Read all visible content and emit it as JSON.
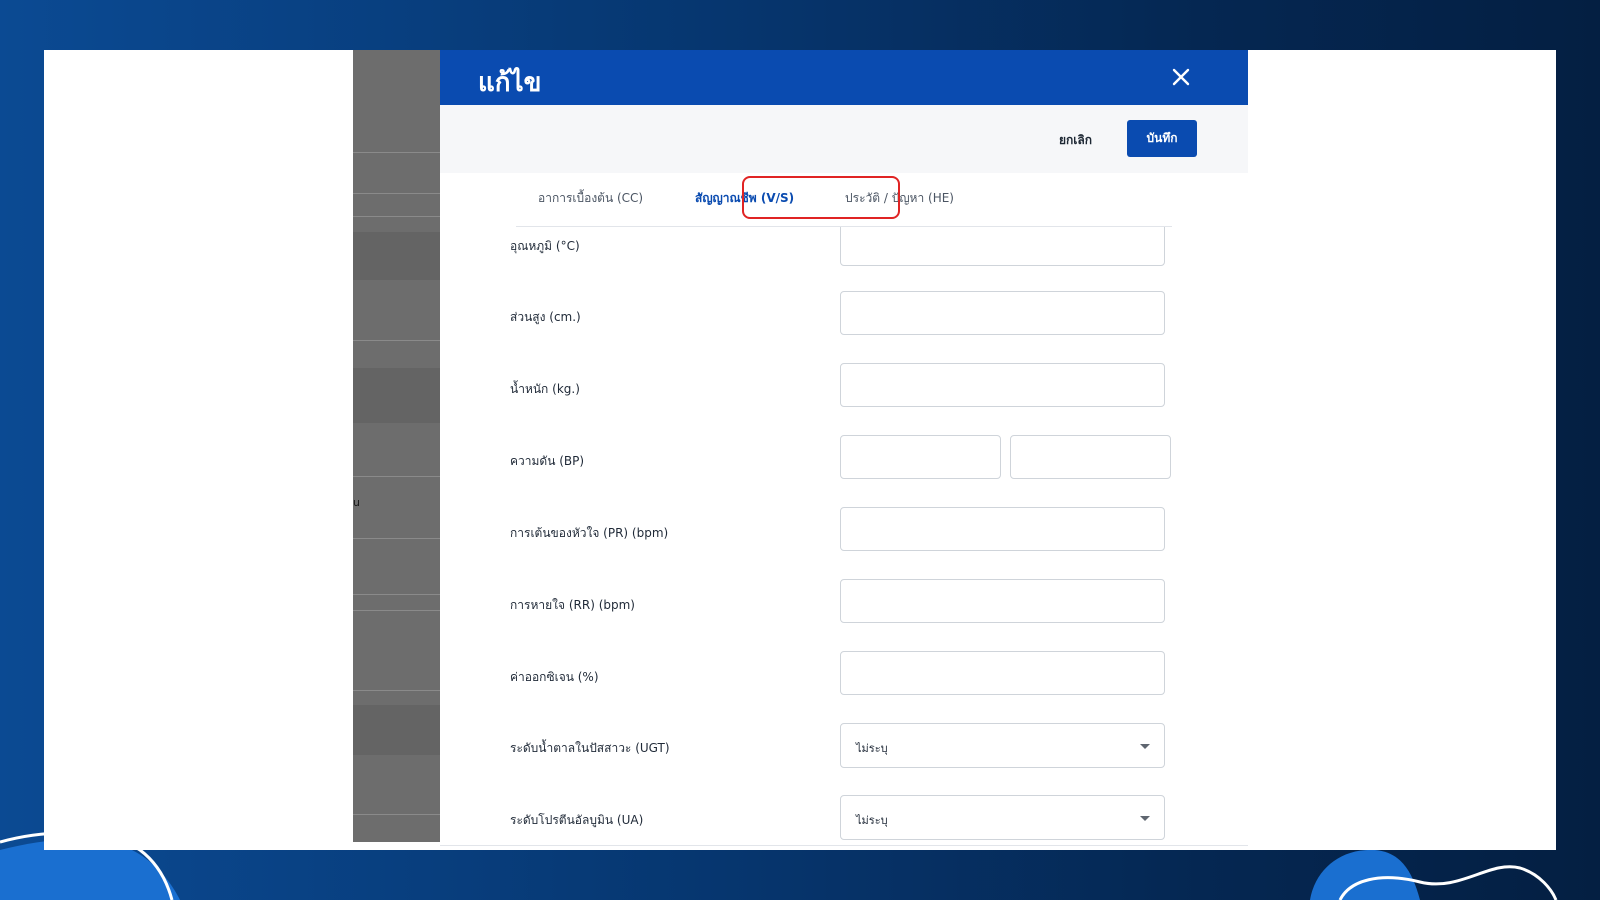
{
  "dialog": {
    "title": "แก้ไข",
    "close_icon": "close-icon",
    "cancel_label": "ยกเลิก",
    "save_label": "บันทึก"
  },
  "tabs": [
    {
      "label": "อาการเบื้องต้น (CC)",
      "active": false
    },
    {
      "label": "สัญญาณชีพ (V/S)",
      "active": true
    },
    {
      "label": "ประวัติ / ปัญหา (HE)",
      "active": false
    }
  ],
  "form": {
    "temperature": {
      "label": "อุณหภูมิ (°C)",
      "value": ""
    },
    "height": {
      "label": "ส่วนสูง (cm.)",
      "value": ""
    },
    "weight": {
      "label": "น้ำหนัก (kg.)",
      "value": ""
    },
    "blood_pressure": {
      "label": "ความดัน (BP)",
      "systolic": "",
      "diastolic": ""
    },
    "pulse_rate": {
      "label": "การเต้นของหัวใจ (PR) (bpm)",
      "value": ""
    },
    "respiratory_rate": {
      "label": "การหายใจ (RR) (bpm)",
      "value": ""
    },
    "oxygen": {
      "label": "ค่าออกซิเจน (%)",
      "value": ""
    },
    "urine_glucose": {
      "label": "ระดับน้ำตาลในปัสสาวะ (UGT)",
      "selected": "ไม่ระบุ"
    },
    "urine_albumin": {
      "label": "ระดับโปรตีนอัลบูมิน (UA)",
      "selected": "ไม่ระบุ"
    }
  },
  "background": {
    "fragment_text": "u"
  },
  "colors": {
    "primary": "#0a4bb0",
    "highlight": "#e02424",
    "backdrop": "#6d6d6d",
    "page_bg_start": "#0b4a93",
    "page_bg_end": "#041f42"
  }
}
